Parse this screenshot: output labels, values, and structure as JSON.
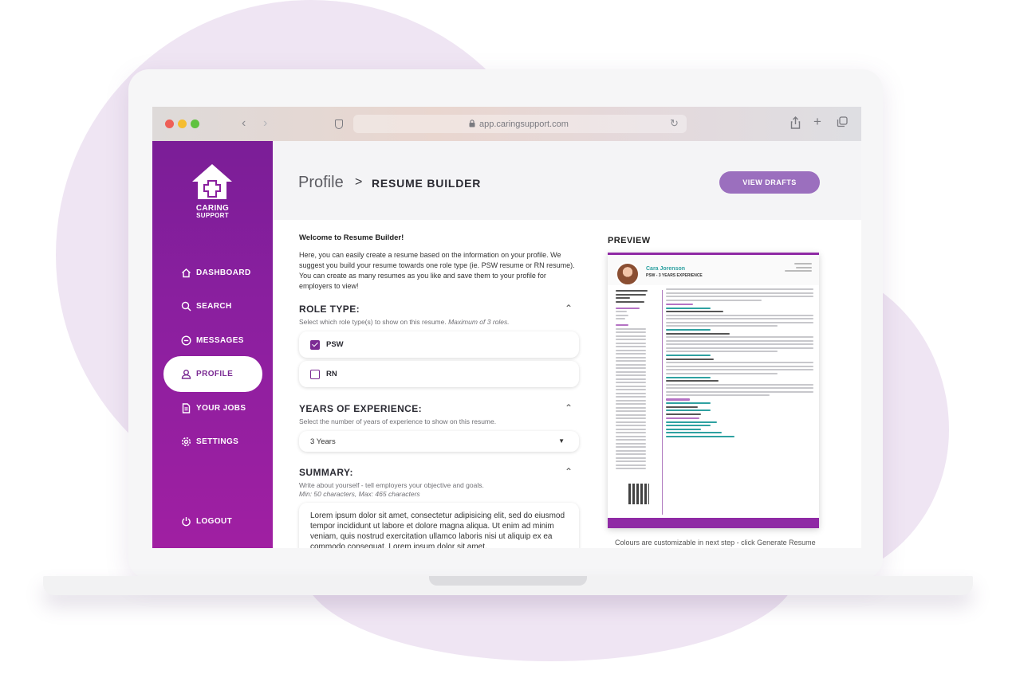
{
  "browser": {
    "url": "app.caringsupport.com"
  },
  "brand": {
    "line1": "CARING",
    "line2": "SUPPORT"
  },
  "nav": {
    "dashboard": "DASHBOARD",
    "search": "SEARCH",
    "messages": "MESSAGES",
    "profile": "PROFILE",
    "jobs": "YOUR JOBS",
    "settings": "SETTINGS",
    "logout": "LOGOUT"
  },
  "header": {
    "title": "Profile",
    "separator": ">",
    "subtitle": "RESUME BUILDER",
    "drafts_button": "VIEW DRAFTS"
  },
  "intro": {
    "title": "Welcome to Resume Builder!",
    "body": "Here, you can easily create a resume based on the information on your profile. We suggest you build your resume towards one role type (ie. PSW resume or RN resume). You can create as many resumes as you like and save them to your profile for employers to view!"
  },
  "role_type": {
    "title": "ROLE TYPE:",
    "help": "Select which role type(s) to show on this resume.",
    "help_italic": "Maximum of 3 roles.",
    "options": [
      {
        "label": "PSW",
        "checked": true
      },
      {
        "label": "RN",
        "checked": false
      }
    ]
  },
  "experience": {
    "title": "YEARS OF EXPERIENCE:",
    "help": "Select the number of years of experience to show on this resume.",
    "value": "3 Years"
  },
  "summary": {
    "title": "SUMMARY:",
    "help": "Write about yourself - tell employers your objective and goals.",
    "limits": "Min: 50 characters, Max: 465 characters",
    "text": "Lorem ipsum dolor sit amet, consectetur adipisicing elit, sed do eiusmod tempor incididunt ut labore et dolore magna aliqua. Ut enim ad minim veniam, quis nostrud exercitation ullamco laboris nisi ut aliquip ex ea commodo consequat. Lorem ipsum dolor sit amet,"
  },
  "preview": {
    "label": "PREVIEW",
    "name": "Cara Jorenson",
    "role": "PSW - 3 YEARS EXPERIENCE",
    "caption": "Colours are customizable in next step - click Generate Resume"
  },
  "colors": {
    "brand_purple": "#8a1f9f",
    "accent_lavender": "#9b6fbe",
    "preview_teal": "#2ea1a1"
  }
}
